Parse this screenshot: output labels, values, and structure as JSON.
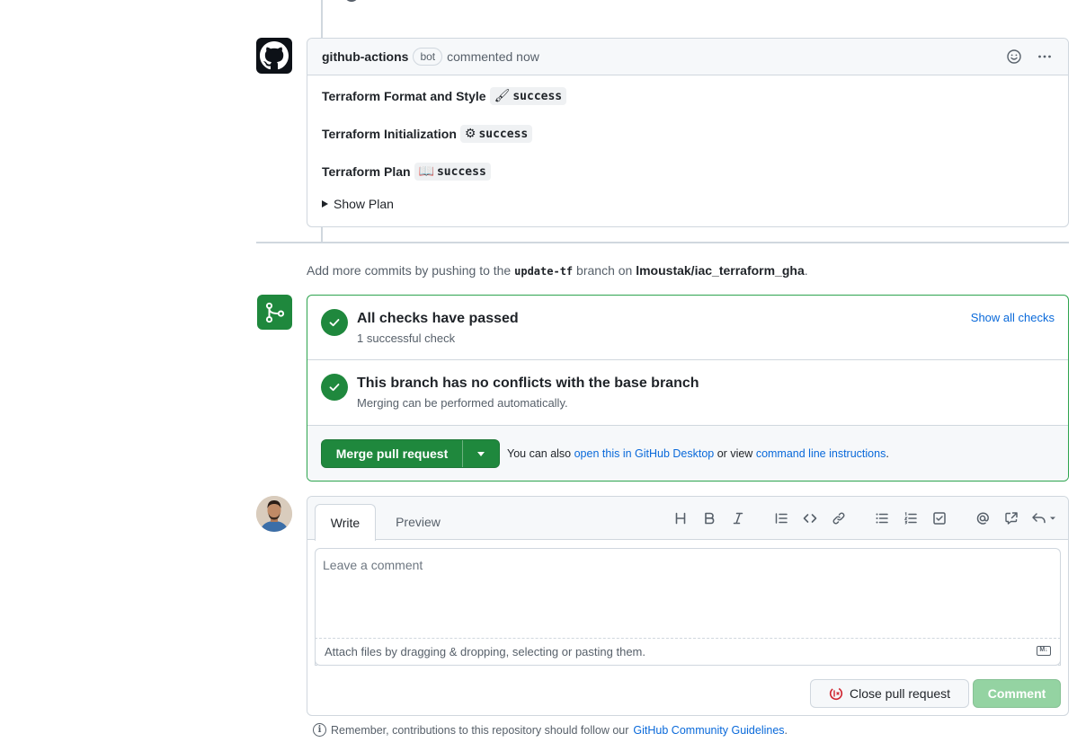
{
  "comment": {
    "author": "github-actions",
    "badge": "bot",
    "action": "commented now",
    "lines": [
      {
        "label": "Terraform Format and Style",
        "emoji": "🖌",
        "status": "success"
      },
      {
        "label": "Terraform Initialization",
        "emoji": "⚙",
        "status": "success"
      },
      {
        "label": "Terraform Plan",
        "emoji": "📖",
        "status": "success"
      }
    ],
    "details_label": "Show Plan",
    "icons": [
      "smiley-icon",
      "kebab-horizontal-icon"
    ]
  },
  "add_commits": {
    "prefix": "Add more commits by pushing to the",
    "branch": "update-tf",
    "middle": "branch on",
    "repo": "lmoustak/iac_terraform_gha",
    "suffix": "."
  },
  "merge": {
    "checks_title": "All checks have passed",
    "checks_sub": "1 successful check",
    "show_all_checks": "Show all checks",
    "conflicts_title": "This branch has no conflicts with the base branch",
    "conflicts_sub": "Merging can be performed automatically.",
    "merge_button": "Merge pull request",
    "note_prefix": "You can also",
    "note_link1": "open this in GitHub Desktop",
    "note_middle": "or view",
    "note_link2": "command line instructions",
    "note_suffix": "."
  },
  "editor": {
    "tab_write": "Write",
    "tab_preview": "Preview",
    "placeholder": "Leave a comment",
    "attach_text": "Attach files by dragging & dropping, selecting or pasting them.",
    "md_badge": "M↓",
    "close_button": "Close pull request",
    "comment_button": "Comment",
    "toolbar_icons": [
      "heading-icon",
      "bold-icon",
      "italic-icon",
      "quote-icon",
      "code-icon",
      "link-icon",
      "unordered-list-icon",
      "ordered-list-icon",
      "task-list-icon",
      "mention-icon",
      "cross-reference-icon",
      "reply-icon"
    ]
  },
  "footer": {
    "prefix": "Remember, contributions to this repository should follow our",
    "link": "GitHub Community Guidelines",
    "suffix": "."
  },
  "colors": {
    "success_green": "#1f883d",
    "link_blue": "#0969da",
    "border": "#d0d7de",
    "danger_red": "#cf222e"
  }
}
